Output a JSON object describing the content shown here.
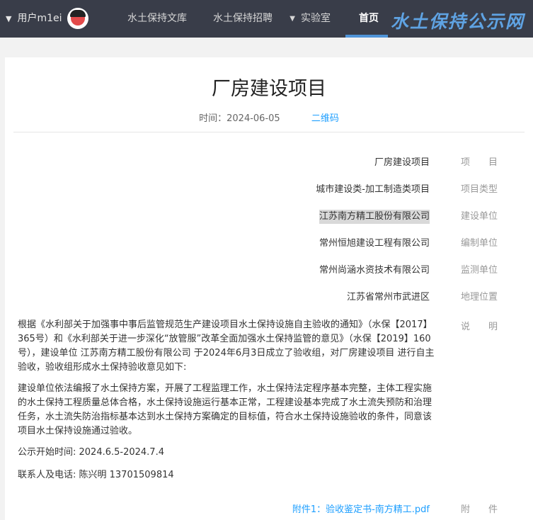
{
  "header": {
    "logo": "水土保持公示网",
    "nav": {
      "home": "首页",
      "lab": "实验室",
      "recruit": "水土保持招聘",
      "library": "水土保持文库"
    },
    "user": "用户m1ei"
  },
  "article": {
    "title": "厂房建设项目",
    "time": "时间：2024-06-05",
    "qr": "二维码",
    "fields": [
      {
        "label": "项　　目",
        "value": "厂房建设项目"
      },
      {
        "label": "项目类型",
        "value": "城市建设类-加工制造类项目"
      },
      {
        "label": "建设单位",
        "value": "江苏南方精工股份有限公司"
      },
      {
        "label": "编制单位",
        "value": "常州恒旭建设工程有限公司"
      },
      {
        "label": "监测单位",
        "value": "常州尚涵水资技术有限公司"
      },
      {
        "label": "地理位置",
        "value": "江苏省常州市武进区"
      }
    ],
    "desc_label": "说　　明",
    "desc": [
      "根据《水利部关于加强事中事后监管规范生产建设项目水土保持设施自主验收的通知》（水保【2017】365号）和《水利部关于进一步深化“放管服”改革全面加强水土保持监管的意见》（水保【2019】160号），建设单位 江苏南方精工股份有限公司 于2024年6月3日成立了验收组，对厂房建设项目 进行自主验收，验收组形成水土保持验收意见如下:",
      "建设单位依法编报了水土保持方案，开展了工程监理工作，水土保持法定程序基本完整，主体工程实施的水土保持工程质量总体合格，水土保持设施运行基本正常，工程建设基本完成了水土流失预防和治理任务，水土流失防治指标基本达到水土保持方案确定的目标值，符合水土保持设施验收的条件，同意该项目水土保持设施通过验收。",
      "公示开始时间: 2024.6.5-2024.7.4",
      "联系人及电话: 陈兴明 13701509814"
    ],
    "attach_label": "附　　件",
    "attachment": "附件1：验收鉴定书-南方精工.pdf"
  }
}
